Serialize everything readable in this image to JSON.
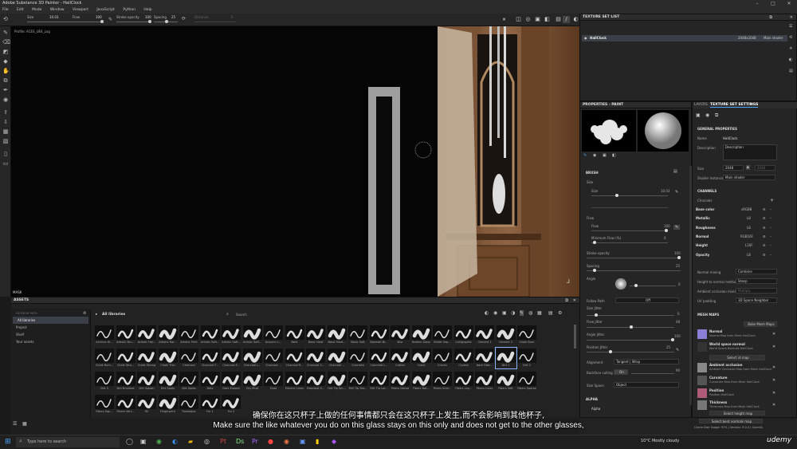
{
  "app": {
    "title": "Adobe Substance 3D Painter - HallClock"
  },
  "menu": [
    "File",
    "Edit",
    "Mode",
    "Window",
    "Viewport",
    "JavaScript",
    "Python",
    "Help"
  ],
  "toolbar": {
    "size_label": "Size",
    "size_value": "10.03",
    "flow_label": "Flow",
    "flow_value": "100",
    "stroke_opacity_label": "Stroke opacity",
    "stroke_opacity_value": "100",
    "spacing_label": "Spacing",
    "spacing_value": "25",
    "distance_label": "Distance",
    "distance_value": "0"
  },
  "viewport": {
    "profile": "Profile: ACES_UE4_Log",
    "mode": "Material",
    "mask_label": "MASK"
  },
  "texture_set_list": {
    "title": "TEXTURE SET LIST",
    "item_name": "HallClock",
    "item_size": "2048x2048",
    "item_shader": "Main shader"
  },
  "properties": {
    "title": "PROPERTIES - PAINT",
    "brush_section": "BRUSH",
    "size_label": "Size",
    "size_value": "10.03",
    "flow_label": "Flow",
    "flow_value": "100",
    "min_flow_label": "Minimum Flow (%)",
    "min_flow_value": "0",
    "stroke_opacity_label": "Stroke opacity",
    "stroke_opacity_value": "100",
    "spacing_label": "Spacing",
    "spacing_value": "25",
    "angle_label": "Angle",
    "angle_value": "0",
    "follow_path_label": "Follow Path",
    "follow_path_value": "Off",
    "size_jitter_label": "Size Jitter",
    "size_jitter_value": "0",
    "flow_jitter_label": "Flow Jitter",
    "flow_jitter_value": "48",
    "angle_jitter_label": "Angle Jitter",
    "angle_jitter_value": "100",
    "position_jitter_label": "Position Jitter",
    "position_jitter_value": "25",
    "alignment_label": "Alignment",
    "alignment_value": "Tangent | Wrap",
    "backface_label": "Backface culling",
    "backface_value": "On",
    "backface_num": "90",
    "size_space_label": "Size Space",
    "size_space_value": "Object",
    "alpha_section": "ALPHA",
    "alpha_name": "Alpha"
  },
  "layers_panel": {
    "tab_layers": "LAYERS",
    "tab_tss": "TEXTURE SET SETTINGS",
    "general_section": "GENERAL PROPERTIES",
    "name_label": "Name",
    "name_value": "HallClock",
    "desc_label": "Description",
    "desc_value": "Description",
    "size_label": "Size",
    "size_value": "2048",
    "size_value2": "2048",
    "shader_label": "Shader Instance",
    "shader_value": "Main shader",
    "channels_section": "CHANNELS",
    "channels_label": "Channels",
    "channels": [
      {
        "name": "Base color",
        "format": "sRGB8"
      },
      {
        "name": "Metallic",
        "format": "L8"
      },
      {
        "name": "Roughness",
        "format": "L8"
      },
      {
        "name": "Normal",
        "format": "RGB16F"
      },
      {
        "name": "Height",
        "format": "L16F"
      },
      {
        "name": "Opacity",
        "format": "L8"
      }
    ],
    "normal_mixing_label": "Normal mixing",
    "normal_mixing_value": "Combine",
    "height_to_normal_label": "Height to normal method",
    "height_to_normal_value": "Sharp",
    "ao_mixing_label": "Ambient occlusion mixing",
    "ao_mixing_value": "Multiply",
    "uv_padding_label": "UV padding",
    "uv_padding_value": "3D Space Neighbor",
    "mesh_maps_section": "MESH MAPS",
    "bake_button": "Bake Mesh Maps",
    "maps": [
      {
        "name": "Normal",
        "desc": "Normal Map from Mesh HallClock"
      },
      {
        "name": "World space normal",
        "desc": "World Space Normals HallClock",
        "action": "Select id map"
      },
      {
        "name": "Ambient occlusion",
        "desc": "Ambient Occlusion Map from Mesh HallClock"
      },
      {
        "name": "Curvature",
        "desc": "Curvature Map from Mesh HallClock"
      },
      {
        "name": "Position",
        "desc": "Position HallClock"
      },
      {
        "name": "Thickness",
        "desc": "Thickness Map from Mesh HallClock",
        "action": "Select height map"
      }
    ],
    "select_bent_normals": "Select bent normals map",
    "cache_status": "Cache Disk Usage: 97% | Version: 9.0.0 | OpenGL"
  },
  "assets": {
    "title": "ASSETS",
    "filter_label": "FILTER BY PATH",
    "sidebar": [
      "All libraries",
      "Project",
      "Shelf",
      "Your assets"
    ],
    "breadcrumb": "All libraries",
    "search_placeholder": "Search",
    "row1": [
      "Archive Hi...",
      "Artistic Bru...",
      "Artistic Hai...",
      "Artistic Hai...",
      "Artistic Print",
      "Artistic Soft...",
      "Artistic Soft...",
      "Artistic Soft...",
      "Autumn L...",
      "Bark",
      "Basic Hard",
      "Basic Hard...",
      "Basic Soft",
      "Basmati Br...",
      "Blur",
      "Broken Glass",
      "Bullet Imp...",
      "Calligraphic",
      "Cement 1",
      "Cement 2",
      "Chalk Bum"
    ],
    "row2": [
      "Chalk Bum...",
      "Chalk Stro...",
      "Chalk Strong",
      "Chalk Thin",
      "Charcoal",
      "Charcoal F...",
      "Charcoal F...",
      "Charcoal L...",
      "Charcoal ...",
      "Charcoal R...",
      "Charcoal S...",
      "Charcoal ...",
      "Concrete",
      "Concrete L...",
      "Cotton",
      "Crack",
      "Cracks",
      "Crystal",
      "Dark Hatc...",
      "Dirt 1",
      "Dirt 2"
    ],
    "row3": [
      "Dirt 3",
      "Dirt Brushed",
      "Dirt Splash",
      "Dirt Spots",
      "Dirt Spots",
      "Dots",
      "Dots Erased",
      "Dry Mud",
      "Dust",
      "Electric Lines",
      "Elephant S...",
      "Felt Tip Sm...",
      "Felt Tip Sta...",
      "Felt Tip Lar...",
      "Fibers Dense",
      "Fibers Nat...",
      "Fibers Inter...",
      "Fibers Lay...",
      "Fibers Lines",
      "Fibers Soft",
      "Fibers Sparse"
    ],
    "row4": [
      "Fibers Squ...",
      "Fibers Vert...",
      "Fill",
      "Fingerprint",
      "Footsteps",
      "Fur 1",
      "Fur 2"
    ]
  },
  "subtitles": {
    "zh": "确保你在这只杯子上做的任何事情都只会在这只杯子上发生,而不会影响到其他杯子,",
    "en": "Make sure the like whatever you do on this glass stays on this only and does not get to the other glasses,"
  },
  "taskbar": {
    "search_placeholder": "Type here to search",
    "weather": "10°C  Mostly cloudy",
    "watermark": "udemy"
  }
}
